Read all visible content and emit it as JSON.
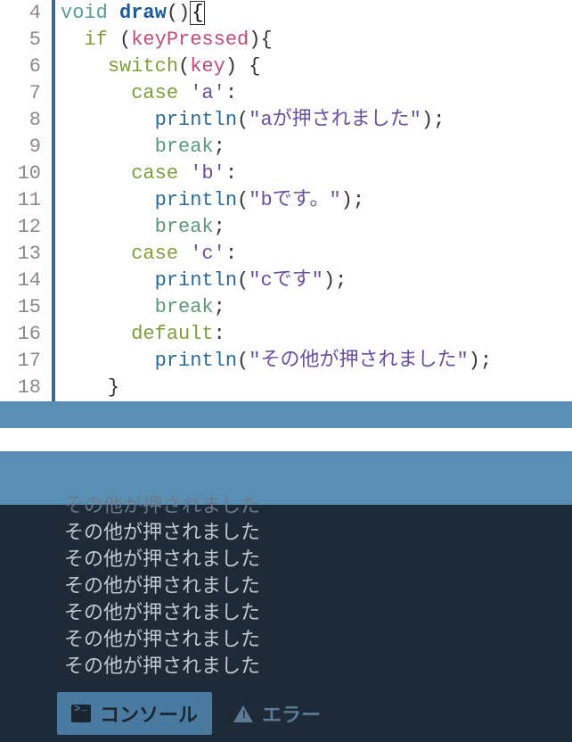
{
  "editor": {
    "lines": [
      {
        "num": "4"
      },
      {
        "num": "5"
      },
      {
        "num": "6"
      },
      {
        "num": "7"
      },
      {
        "num": "8"
      },
      {
        "num": "9"
      },
      {
        "num": "10"
      },
      {
        "num": "11"
      },
      {
        "num": "12"
      },
      {
        "num": "13"
      },
      {
        "num": "14"
      },
      {
        "num": "15"
      },
      {
        "num": "16"
      },
      {
        "num": "17"
      },
      {
        "num": "18"
      }
    ],
    "tok": {
      "void": "void",
      "draw": "draw",
      "if": "if",
      "keyPressed": "keyPressed",
      "switch": "switch",
      "key": "key",
      "case": "case",
      "char_a": "'a'",
      "char_b": "'b'",
      "char_c": "'c'",
      "println": "println",
      "str_a": "\"aが押されました\"",
      "str_b": "\"bです。\"",
      "str_c": "\"cです\"",
      "str_other": "\"その他が押されました\"",
      "break": "break",
      "default": "default",
      "colon": ":",
      "semi": ";",
      "lparen": "(",
      "rparen": ")",
      "lbrace": "{",
      "rbrace": "}",
      "cursor_brace": "{"
    }
  },
  "console": {
    "lines": [
      "その他が押されました",
      "その他が押されました",
      "その他が押されました",
      "その他が押されました",
      "その他が押されました",
      "その他が押されました",
      "その他が押されました"
    ]
  },
  "tabs": {
    "console": "コンソール",
    "error": "エラー"
  }
}
